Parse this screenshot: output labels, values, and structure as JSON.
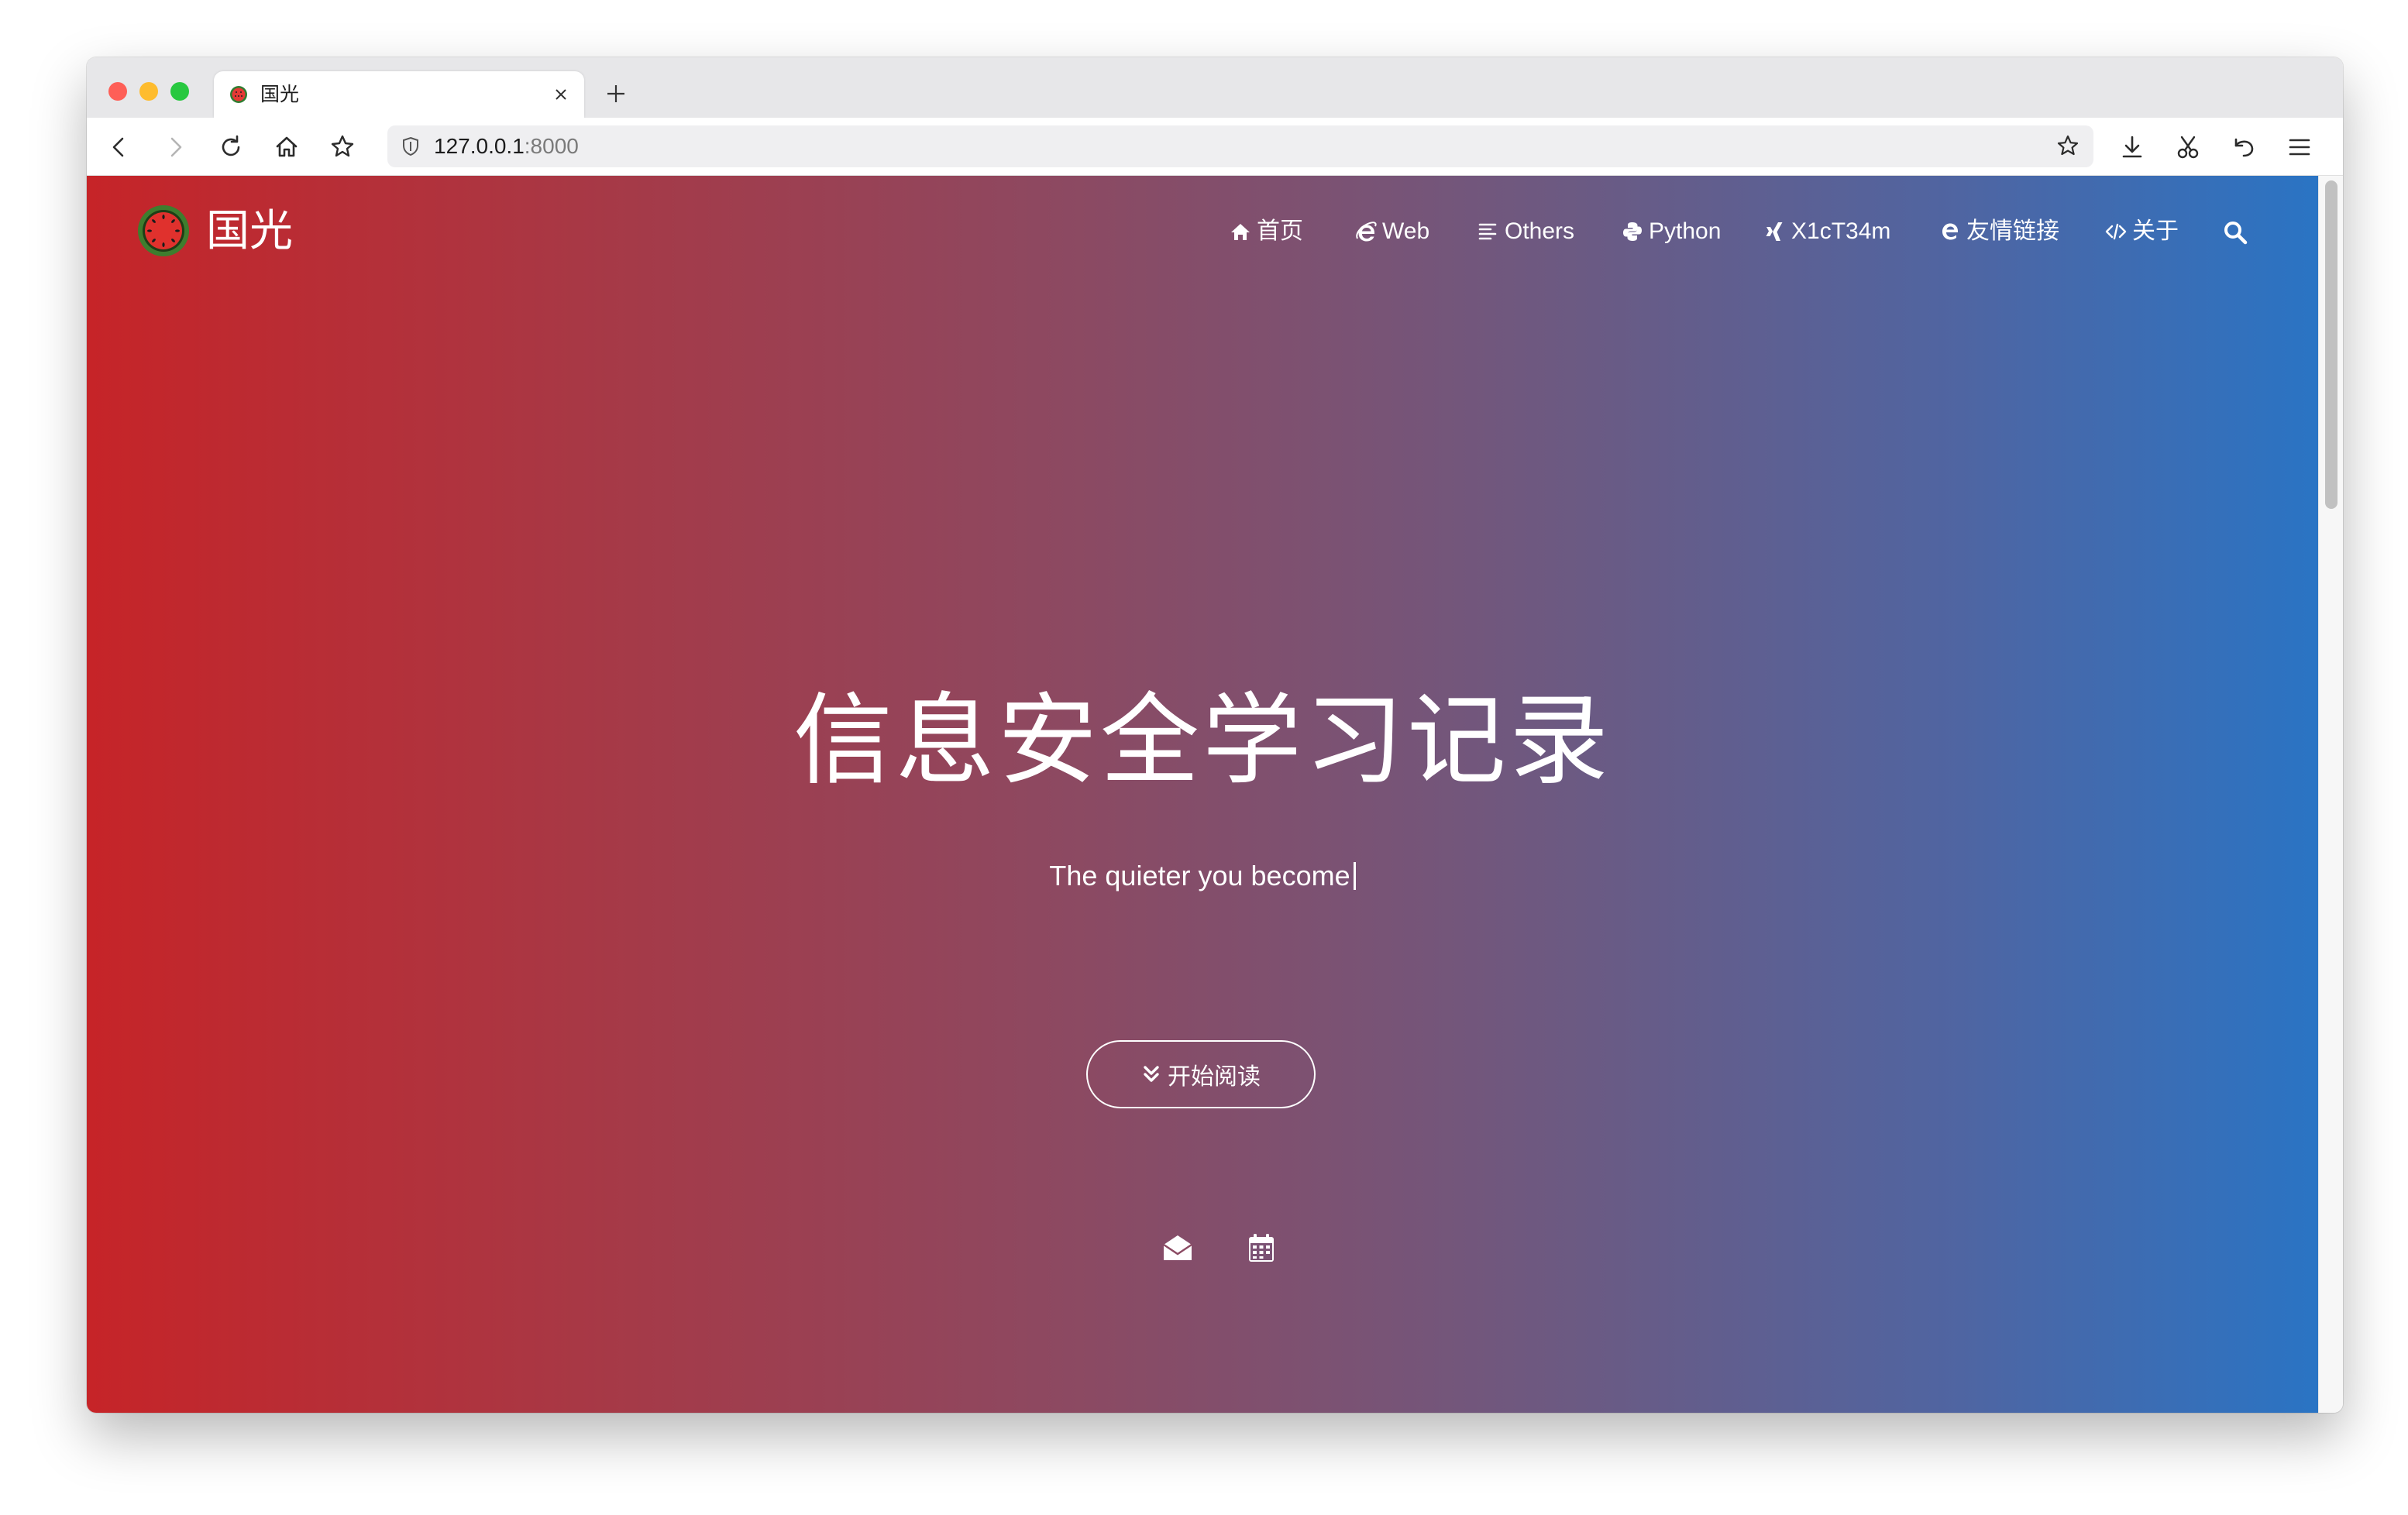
{
  "browser": {
    "tab": {
      "title": "国光",
      "favicon": "watermelon-icon"
    },
    "url": {
      "host": "127.0.0.1",
      "port": ":8000"
    },
    "toolbar_icons": [
      "back-icon",
      "forward-icon",
      "reload-icon",
      "home-icon",
      "bookmark-star-icon",
      "download-icon",
      "scissors-icon",
      "undo-icon",
      "menu-icon"
    ]
  },
  "site": {
    "brand": "国光",
    "nav": [
      {
        "label": "首页",
        "icon": "home-icon"
      },
      {
        "label": "Web",
        "icon": "ie-icon"
      },
      {
        "label": "Others",
        "icon": "list-icon"
      },
      {
        "label": "Python",
        "icon": "python-icon"
      },
      {
        "label": "X1cT34m",
        "icon": "xing-icon"
      },
      {
        "label": "友情链接",
        "icon": "edge-icon"
      },
      {
        "label": "关于",
        "icon": "code-icon"
      }
    ],
    "hero": {
      "title": "信息安全学习记录",
      "subtitle": "The quieter you become",
      "button_label": "开始阅读"
    },
    "social_icons": [
      "envelope-open-icon",
      "calendar-icon"
    ]
  },
  "colors": {
    "gradient_left": "#c62428",
    "gradient_right": "#2a74c4",
    "text": "#ffffff"
  }
}
